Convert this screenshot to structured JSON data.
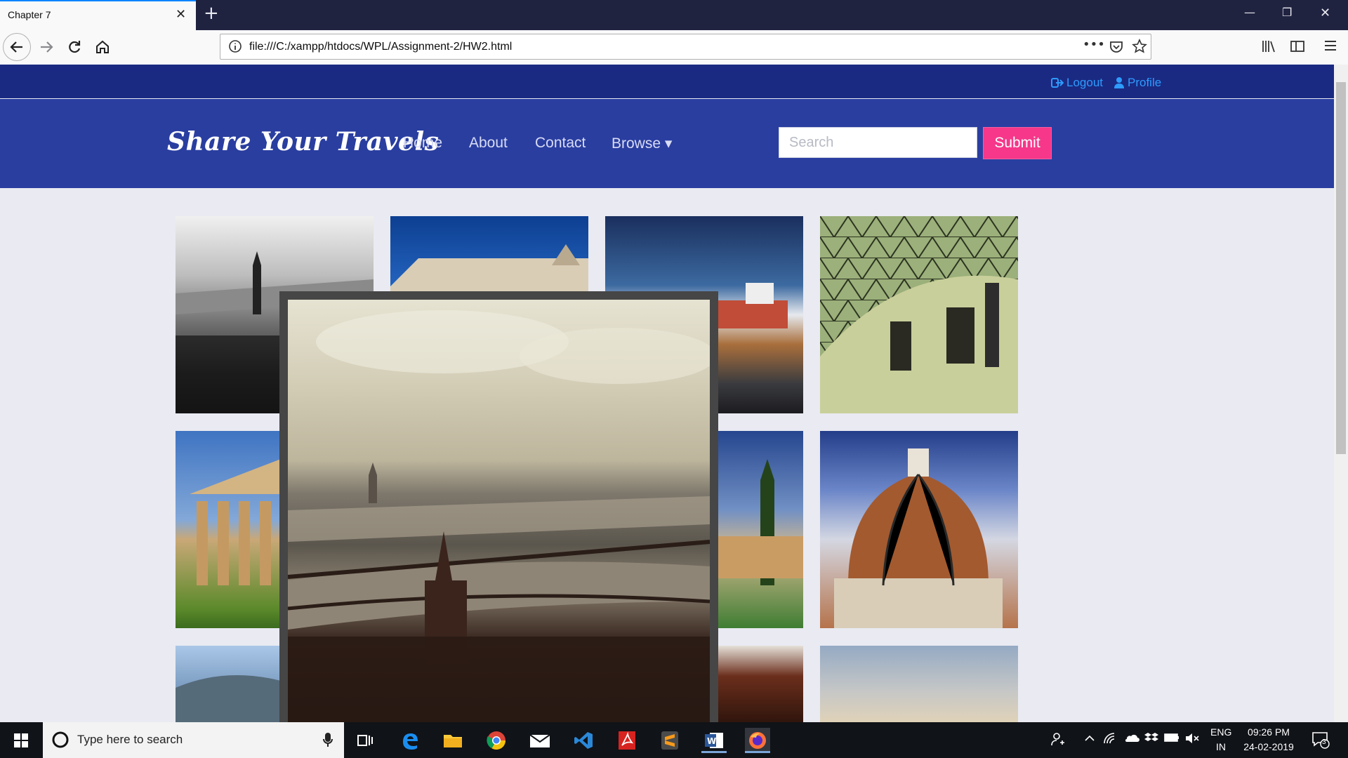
{
  "browser": {
    "tab_title": "Chapter 7",
    "tab_close": "✕",
    "new_tab": "+",
    "url": "file:///C:/xampp/htdocs/WPL/Assignment-2/HW2.html",
    "more_label": "•••"
  },
  "site": {
    "top_links": {
      "logout": "Logout",
      "profile": "Profile"
    },
    "brand": "Share Your Travels",
    "menu": [
      {
        "label": "Home"
      },
      {
        "label": "About"
      },
      {
        "label": "Contact"
      },
      {
        "label": "Browse ▾"
      }
    ],
    "search_placeholder": "Search",
    "submit_label": "Submit"
  },
  "taskbar": {
    "search_placeholder": "Type here to search",
    "lang_top": "ENG",
    "lang_bottom": "IN",
    "time": "09:26 PM",
    "date": "24-02-2019",
    "notifications": "3"
  },
  "colors": {
    "site_top": "#1a2a82",
    "site_nav": "#2a3ea0",
    "submit": "#f6378a",
    "link": "#2e9bff"
  }
}
